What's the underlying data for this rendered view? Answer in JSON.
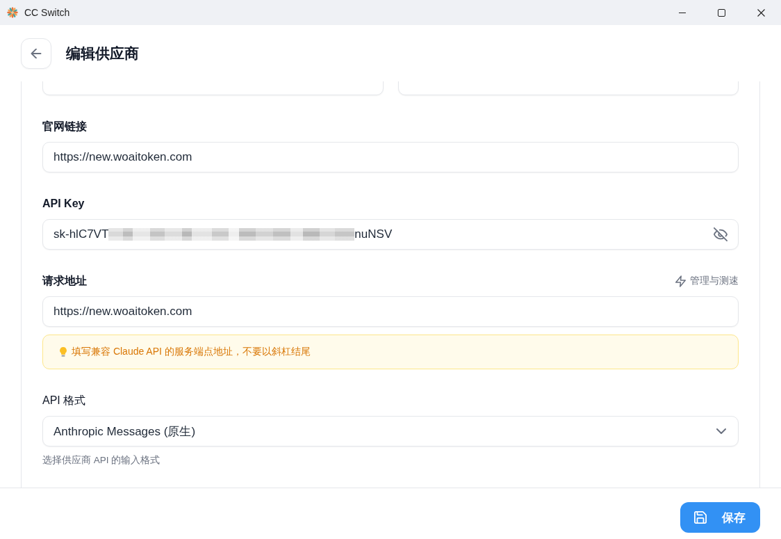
{
  "window": {
    "title": "CC Switch"
  },
  "header": {
    "title": "编辑供应商"
  },
  "form": {
    "top_row": [
      {
        "kind": "input"
      },
      {
        "kind": "input"
      }
    ],
    "fields": [
      {
        "kind": "text",
        "label": "官网链接",
        "value": "https://new.woaitoken.com"
      },
      {
        "kind": "secret",
        "label": "API Key",
        "value_start": "sk-hlC7VT",
        "value_end": "nuNSV",
        "revealed": true
      },
      {
        "kind": "text",
        "label": "请求地址",
        "action": "管理与测速",
        "value": "https://new.woaitoken.com",
        "hint": "填写兼容 Claude API 的服务端点地址，不要以斜杠结尾"
      },
      {
        "kind": "select",
        "label": "API 格式",
        "value": "Anthropic Messages (原生)",
        "help": "选择供应商 API 的输入格式"
      }
    ]
  },
  "footer": {
    "save_button": "保存"
  }
}
